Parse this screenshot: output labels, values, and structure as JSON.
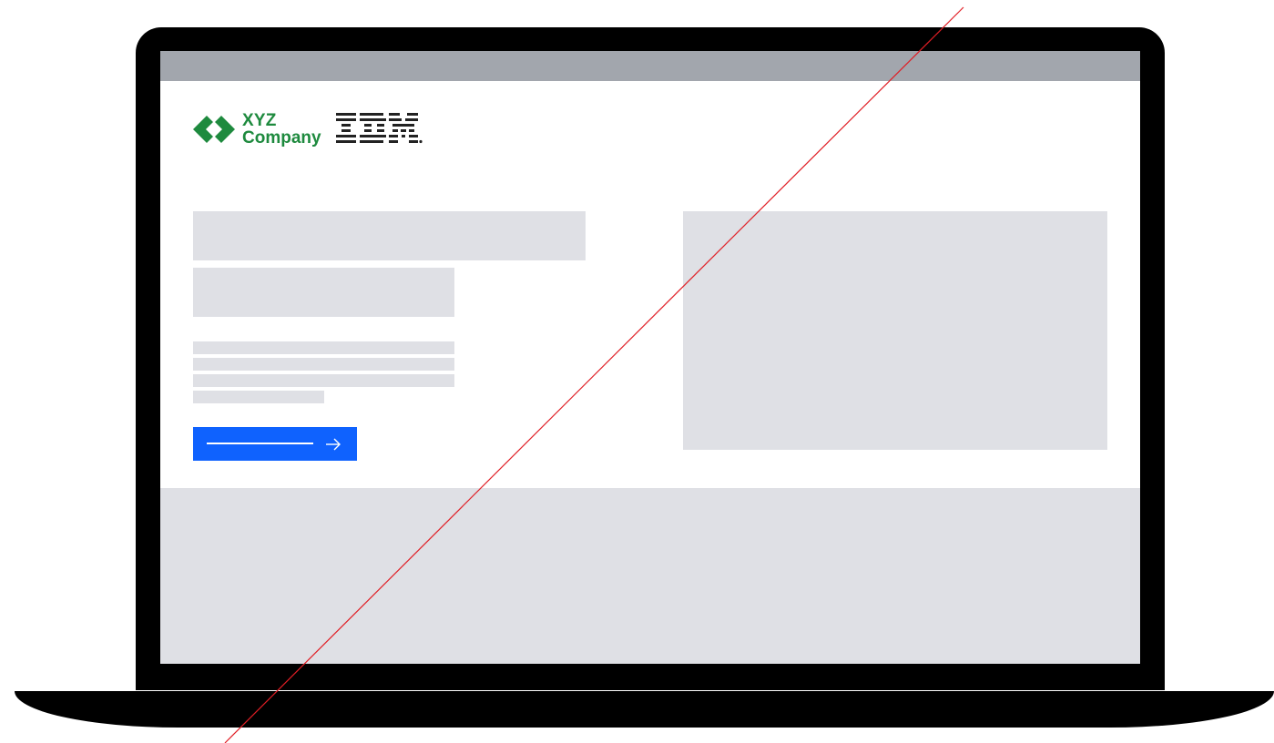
{
  "brand": {
    "company_line1": "XYZ",
    "company_line2": "Company",
    "company_color": "#1e8a3e",
    "ibm_logo_icon": "ibm-logo-icon",
    "xyz_logo_icon": "xyz-diamond-icon"
  },
  "colors": {
    "browser_bar": "#a2a6ad",
    "placeholder": "#dfe0e5",
    "cta": "#0f62fe",
    "device": "#000000",
    "overlay_line": "#e01e25"
  },
  "cta": {
    "icon": "arrow-right-icon"
  }
}
